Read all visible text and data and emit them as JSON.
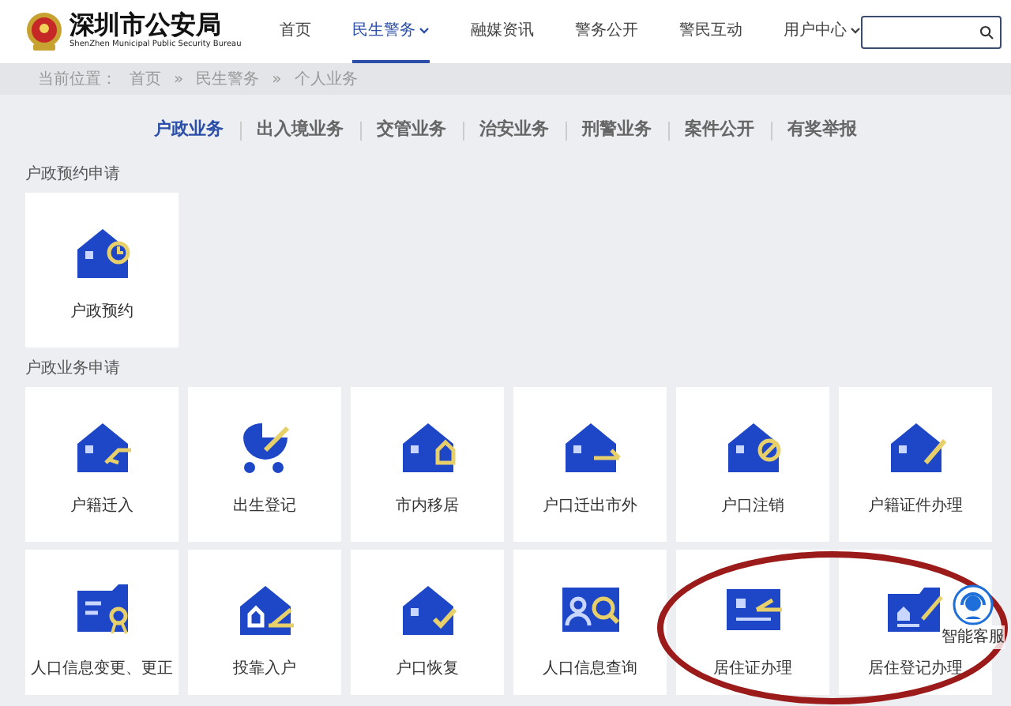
{
  "header": {
    "title": "深圳市公安局",
    "subtitle": "ShenZhen Municipal Public Security Bureau",
    "nav": [
      {
        "label": "首页",
        "selected": false,
        "dropdown": false
      },
      {
        "label": "民生警务",
        "selected": true,
        "dropdown": true
      },
      {
        "label": "融媒资讯",
        "selected": false,
        "dropdown": false
      },
      {
        "label": "警务公开",
        "selected": false,
        "dropdown": false
      },
      {
        "label": "警民互动",
        "selected": false,
        "dropdown": false
      },
      {
        "label": "用户中心",
        "selected": false,
        "dropdown": true
      }
    ]
  },
  "breadcrumb": [
    "当前位置：",
    "首页",
    "»",
    "民生警务",
    "»",
    "个人业务"
  ],
  "tabs": [
    {
      "label": "户政业务",
      "selected": true
    },
    {
      "label": "出入境业务",
      "selected": false
    },
    {
      "label": "交管业务",
      "selected": false
    },
    {
      "label": "治安业务",
      "selected": false
    },
    {
      "label": "刑警业务",
      "selected": false
    },
    {
      "label": "案件公开",
      "selected": false
    },
    {
      "label": "有奖举报",
      "selected": false
    }
  ],
  "sections": [
    {
      "title": "户政预约申请",
      "items": [
        "户政预约"
      ]
    },
    {
      "title": "户政业务申请",
      "items": [
        "户籍迁入",
        "出生登记",
        "市内移居",
        "户口迁出市外",
        "户口注销",
        "户籍证件办理",
        "人口信息变更、更正",
        "投靠入户",
        "户口恢复",
        "人口信息查询",
        "居住证办理",
        "居住登记办理"
      ]
    }
  ],
  "chat_widget": {
    "label": "智能客服"
  },
  "annotation_ellipse": true
}
